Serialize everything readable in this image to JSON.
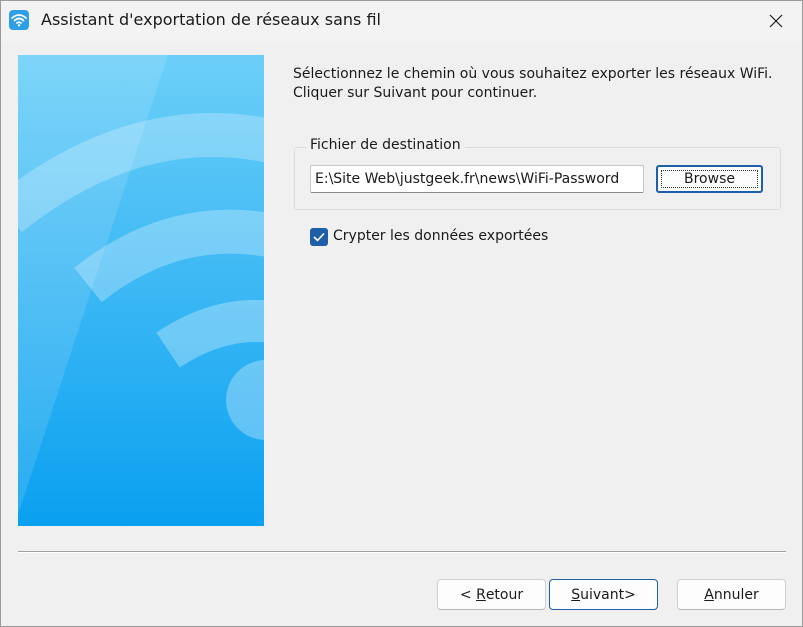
{
  "window": {
    "title": "Assistant d'exportation de réseaux sans fil",
    "icon": "wifi-icon",
    "close_icon": "close-icon"
  },
  "instruction": {
    "line1": "Sélectionnez le chemin où vous souhaitez exporter les réseaux WiFi.",
    "line2": "Cliquer sur Suivant pour continuer."
  },
  "destination": {
    "group_label": "Fichier de destination",
    "path_value": "E:\\Site Web\\justgeek.fr\\news\\WiFi-Password",
    "browse_label": "Browse"
  },
  "encrypt": {
    "label": "Crypter les données exportées",
    "checked": true
  },
  "buttons": {
    "back_prefix": "< ",
    "back_mnemonic": "R",
    "back_rest": "etour",
    "next_mnemonic": "S",
    "next_rest": "uivant>",
    "cancel_mnemonic": "A",
    "cancel_rest": "nnuler"
  },
  "colors": {
    "accent": "#1f5fa8",
    "side_image": "#25aaf2"
  }
}
